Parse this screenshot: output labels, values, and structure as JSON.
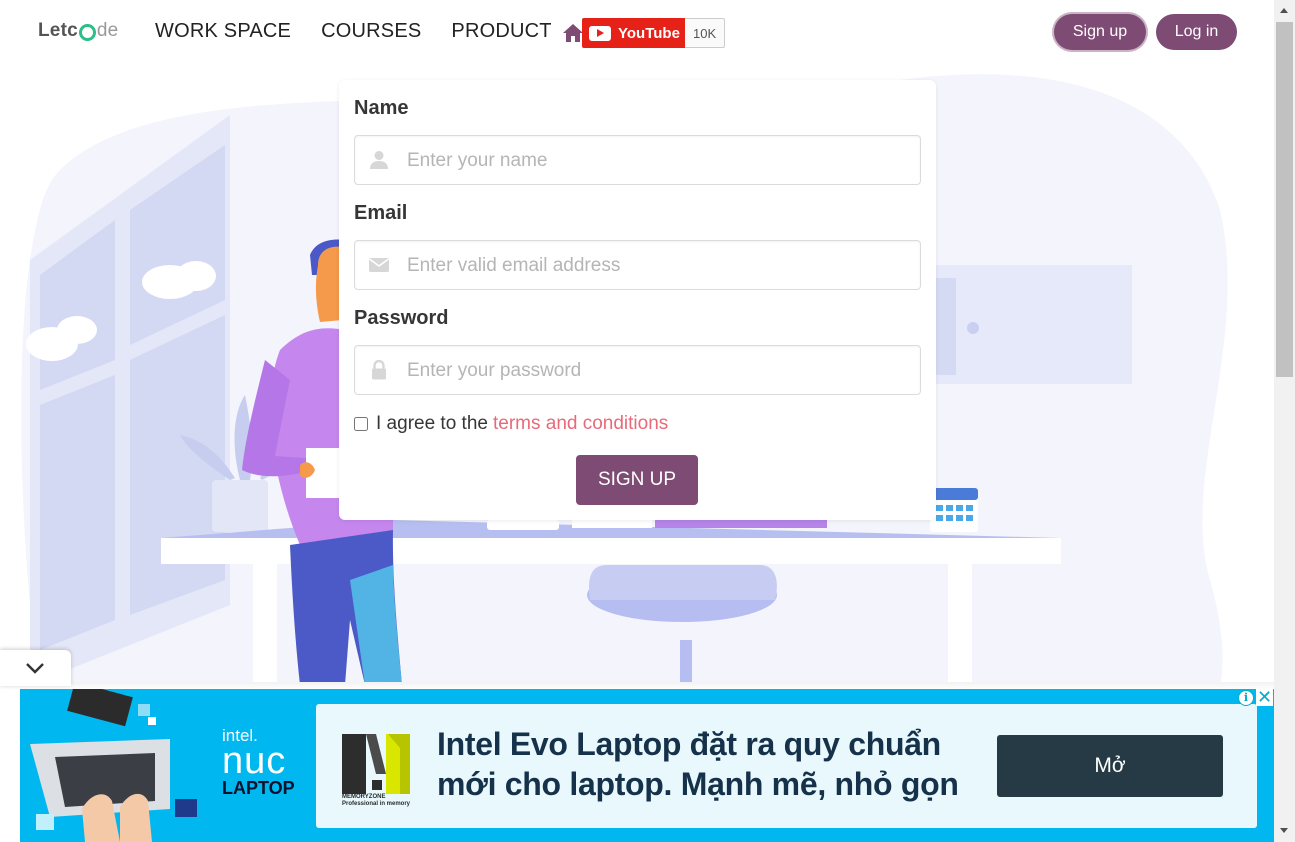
{
  "header": {
    "logo": {
      "part1": "Letc",
      "part2": "de"
    },
    "nav": [
      {
        "label": "WORK SPACE"
      },
      {
        "label": "COURSES"
      },
      {
        "label": "PRODUCT"
      }
    ],
    "youtube": {
      "label": "YouTube",
      "count": "10K"
    },
    "signup_label": "Sign up",
    "login_label": "Log in"
  },
  "form": {
    "name_label": "Name",
    "name_placeholder": "Enter your name",
    "email_label": "Email",
    "email_placeholder": "Enter valid email address",
    "password_label": "Password",
    "password_placeholder": "Enter your password",
    "agree_text": "I agree to the",
    "terms_link": "terms and conditions",
    "submit_label": "SIGN UP"
  },
  "ad": {
    "brand_intel": "intel.",
    "brand_nuc": "nuc",
    "brand_laptop": "LAPTOP",
    "store_name": "MEMORYZONE",
    "store_tagline": "Professional in memory",
    "headline_line1": "Intel Evo Laptop đặt ra quy chuẩn",
    "headline_line2": "mới cho laptop. Mạnh mẽ, nhỏ gọn",
    "cta_label": "Mở",
    "info_label": "i",
    "close_label": "✕"
  },
  "colors": {
    "brand_purple": "#7d4b73",
    "terms_pink": "#e86a7a",
    "ad_blue": "#00b7ef",
    "illustration_lavender": "#eef0fb"
  }
}
